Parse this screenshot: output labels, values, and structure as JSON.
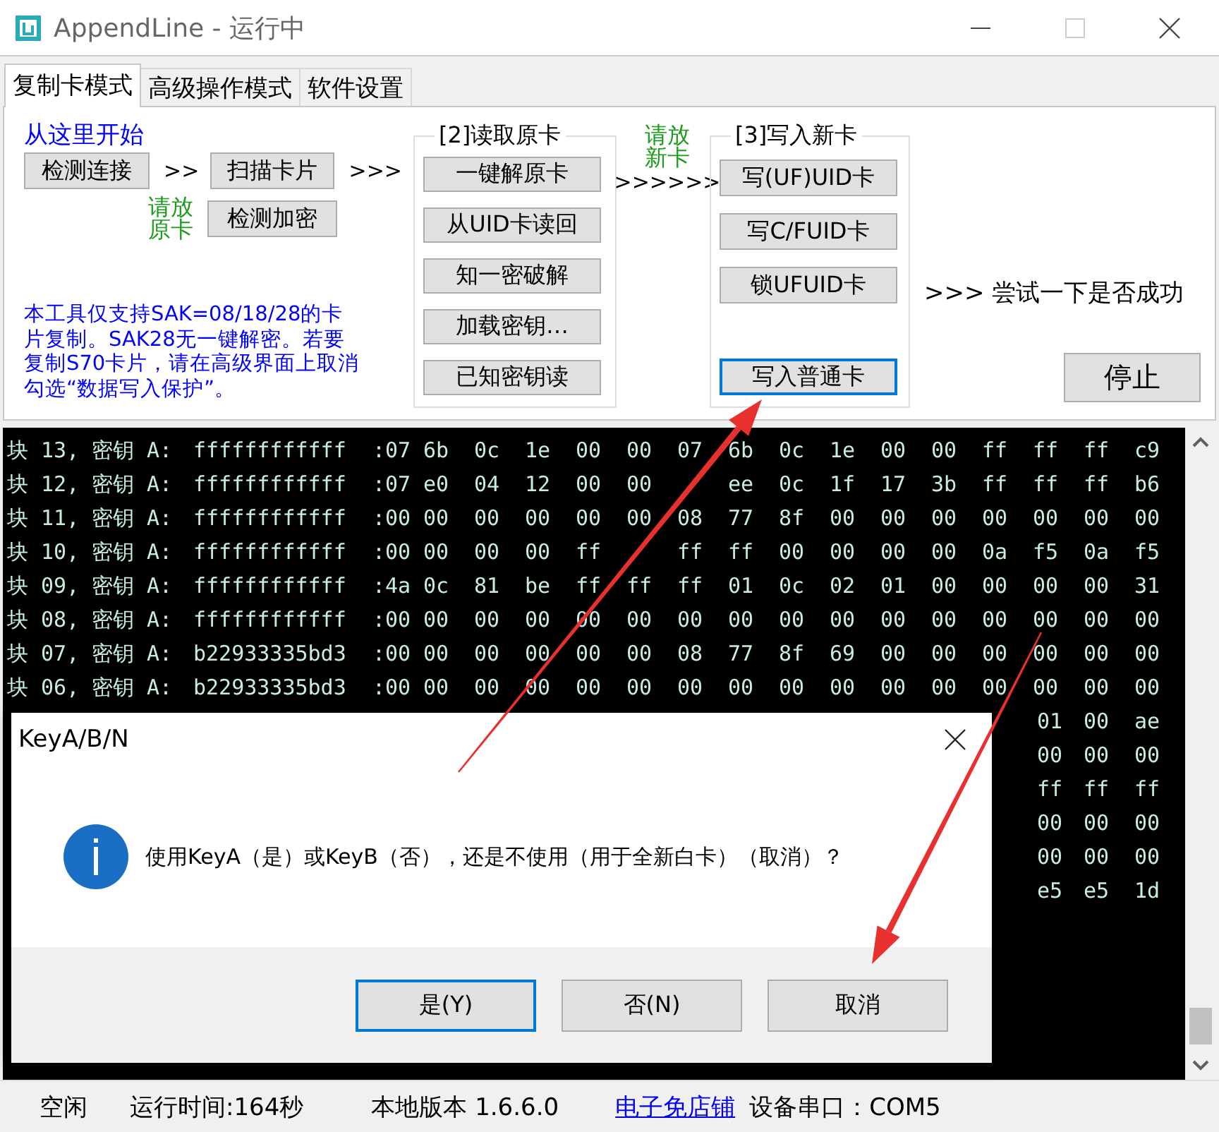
{
  "window": {
    "title": "AppendLine - 运行中"
  },
  "tabs": [
    {
      "label": "复制卡模式",
      "selected": true
    },
    {
      "label": "高级操作模式",
      "selected": false
    },
    {
      "label": "软件设置",
      "selected": false
    }
  ],
  "copy_panel": {
    "start_label": "从这里开始",
    "connect_button": "检测连接",
    "arrow_1": ">>",
    "scan_button": "扫描卡片",
    "arrow_2": ">>>",
    "place_original_hint": "请放原卡",
    "detect_encryption_button": "检测加密",
    "note": "本工具仅支持SAK=08/18/28的卡片复制。SAK28无一键解密。若要复制S70卡片，请在高级界面上取消勾选“数据写入保护”。",
    "read_group": {
      "title": "[2]读取原卡",
      "buttons": [
        "一键解原卡",
        "从UID卡读回",
        "知一密破解",
        "加载密钥…",
        "已知密钥读"
      ]
    },
    "place_new_hint": "请放新卡",
    "arrow_3": ">>>>>>",
    "write_group": {
      "title": "[3]写入新卡",
      "buttons": [
        {
          "label": "写(UF)UID卡",
          "focused": false
        },
        {
          "label": "写C/FUID卡",
          "focused": false
        },
        {
          "label": "锁UFUID卡",
          "focused": false
        },
        {
          "label": "写入普通卡",
          "focused": true
        }
      ]
    },
    "try_hint": ">>> 尝试一下是否成功",
    "stop_button": "停止"
  },
  "console": {
    "lines": [
      {
        "block": "块 13,",
        "key_label": "密钥 A:",
        "key": "ffffffffffff",
        "bytes": [
          ":07",
          "6b",
          "0c",
          "1e",
          "00",
          "00",
          "07",
          "6b",
          "0c",
          "1e",
          "00",
          "00",
          "ff",
          "ff",
          "ff",
          "c9"
        ]
      },
      {
        "block": "块 12,",
        "key_label": "密钥 A:",
        "key": "ffffffffffff",
        "bytes": [
          ":07",
          "e0",
          "04",
          "12",
          "00",
          "00"
        ],
        "bytes_after_gap": [
          "ee",
          "0c",
          "1f",
          "17",
          "3b",
          "ff",
          "ff",
          "ff",
          "b6"
        ]
      },
      {
        "block": "块 11,",
        "key_label": "密钥 A:",
        "key": "ffffffffffff",
        "bytes": [
          ":00",
          "00",
          "00",
          "00",
          "00",
          "00",
          "08",
          "77",
          "8f",
          "00",
          "00",
          "00",
          "00",
          "00",
          "00",
          "00"
        ]
      },
      {
        "block": "块 10,",
        "key_label": "密钥 A:",
        "key": "ffffffffffff",
        "bytes": [
          ":00",
          "00",
          "00",
          "00",
          "ff"
        ],
        "bytes_after_gap": [
          "ff",
          "ff",
          "00",
          "00",
          "00",
          "00",
          "0a",
          "f5",
          "0a",
          "f5"
        ]
      },
      {
        "block": "块 09,",
        "key_label": "密钥 A:",
        "key": "ffffffffffff",
        "bytes": [
          ":4a",
          "0c",
          "81",
          "be",
          "ff",
          "ff",
          "ff",
          "01",
          "0c",
          "02",
          "01",
          "00",
          "00",
          "00",
          "00",
          "31"
        ]
      },
      {
        "block": "块 08,",
        "key_label": "密钥 A:",
        "key": "ffffffffffff",
        "bytes": [
          ":00",
          "00",
          "00",
          "00",
          "00",
          "00",
          "00",
          "00",
          "00",
          "00",
          "00",
          "00",
          "00",
          "00",
          "00",
          "00"
        ]
      },
      {
        "block": "块 07,",
        "key_label": "密钥 A:",
        "key": "b22933335bd3",
        "bytes": [
          ":00",
          "00",
          "00",
          "00",
          "00",
          "00",
          "08",
          "77",
          "8f",
          "69",
          "00",
          "00",
          "00",
          "00",
          "00",
          "00"
        ]
      },
      {
        "block": "块 06,",
        "key_label": "密钥 A:",
        "key": "b22933335bd3",
        "bytes": [
          ":00",
          "00",
          "00",
          "00",
          "00",
          "00",
          "00",
          "00",
          "00",
          "00",
          "00",
          "00",
          "00",
          "00",
          "00",
          "00"
        ]
      },
      {
        "bytes": [
          "01",
          "00",
          "ae"
        ]
      },
      {
        "bytes": [
          "00",
          "00",
          "00"
        ]
      },
      {
        "bytes": [
          "ff",
          "ff",
          "ff"
        ]
      },
      {
        "bytes": [
          "00",
          "00",
          "00"
        ]
      },
      {
        "bytes": [
          "00",
          "00",
          "00"
        ]
      },
      {
        "bytes": [
          "e5",
          "e5",
          "1d"
        ]
      }
    ]
  },
  "dialog": {
    "title": "KeyA/B/N",
    "message": "使用KeyA（是）或KeyB（否），还是不使用（用于全新白卡）（取消）？",
    "buttons": [
      {
        "label": "是(Y)",
        "selected": true
      },
      {
        "label": "否(N)",
        "selected": false
      },
      {
        "label": "取消",
        "selected": false
      }
    ]
  },
  "status_bar": {
    "status": "空闲",
    "runtime": "运行时间:164秒",
    "version": "本地版本 1.6.6.0",
    "shop_link": "电子免店铺",
    "port": "设备串口：COM5"
  }
}
